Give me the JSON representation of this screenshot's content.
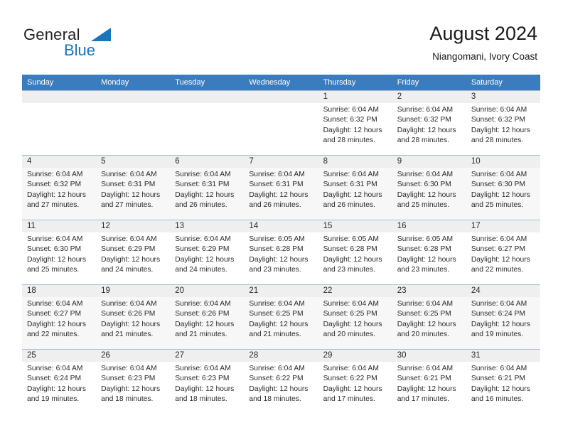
{
  "brand": {
    "line1": "General",
    "line2": "Blue",
    "accent_color": "#1b75bb"
  },
  "header": {
    "title": "August 2024",
    "subtitle": "Niangomani, Ivory Coast"
  },
  "theme": {
    "header_bar_color": "#3a7cbe",
    "daynum_band_color": "#efefef",
    "alt_row_color": "#f7f7f7",
    "grid_line_color": "#a8bfd4"
  },
  "weekdays": [
    "Sunday",
    "Monday",
    "Tuesday",
    "Wednesday",
    "Thursday",
    "Friday",
    "Saturday"
  ],
  "weeks": [
    [
      {
        "day": "",
        "empty": true
      },
      {
        "day": "",
        "empty": true
      },
      {
        "day": "",
        "empty": true
      },
      {
        "day": "",
        "empty": true
      },
      {
        "day": "1",
        "sunrise": "Sunrise: 6:04 AM",
        "sunset": "Sunset: 6:32 PM",
        "daylight1": "Daylight: 12 hours",
        "daylight2": "and 28 minutes."
      },
      {
        "day": "2",
        "sunrise": "Sunrise: 6:04 AM",
        "sunset": "Sunset: 6:32 PM",
        "daylight1": "Daylight: 12 hours",
        "daylight2": "and 28 minutes."
      },
      {
        "day": "3",
        "sunrise": "Sunrise: 6:04 AM",
        "sunset": "Sunset: 6:32 PM",
        "daylight1": "Daylight: 12 hours",
        "daylight2": "and 28 minutes."
      }
    ],
    [
      {
        "day": "4",
        "sunrise": "Sunrise: 6:04 AM",
        "sunset": "Sunset: 6:32 PM",
        "daylight1": "Daylight: 12 hours",
        "daylight2": "and 27 minutes."
      },
      {
        "day": "5",
        "sunrise": "Sunrise: 6:04 AM",
        "sunset": "Sunset: 6:31 PM",
        "daylight1": "Daylight: 12 hours",
        "daylight2": "and 27 minutes."
      },
      {
        "day": "6",
        "sunrise": "Sunrise: 6:04 AM",
        "sunset": "Sunset: 6:31 PM",
        "daylight1": "Daylight: 12 hours",
        "daylight2": "and 26 minutes."
      },
      {
        "day": "7",
        "sunrise": "Sunrise: 6:04 AM",
        "sunset": "Sunset: 6:31 PM",
        "daylight1": "Daylight: 12 hours",
        "daylight2": "and 26 minutes."
      },
      {
        "day": "8",
        "sunrise": "Sunrise: 6:04 AM",
        "sunset": "Sunset: 6:31 PM",
        "daylight1": "Daylight: 12 hours",
        "daylight2": "and 26 minutes."
      },
      {
        "day": "9",
        "sunrise": "Sunrise: 6:04 AM",
        "sunset": "Sunset: 6:30 PM",
        "daylight1": "Daylight: 12 hours",
        "daylight2": "and 25 minutes."
      },
      {
        "day": "10",
        "sunrise": "Sunrise: 6:04 AM",
        "sunset": "Sunset: 6:30 PM",
        "daylight1": "Daylight: 12 hours",
        "daylight2": "and 25 minutes."
      }
    ],
    [
      {
        "day": "11",
        "sunrise": "Sunrise: 6:04 AM",
        "sunset": "Sunset: 6:30 PM",
        "daylight1": "Daylight: 12 hours",
        "daylight2": "and 25 minutes."
      },
      {
        "day": "12",
        "sunrise": "Sunrise: 6:04 AM",
        "sunset": "Sunset: 6:29 PM",
        "daylight1": "Daylight: 12 hours",
        "daylight2": "and 24 minutes."
      },
      {
        "day": "13",
        "sunrise": "Sunrise: 6:04 AM",
        "sunset": "Sunset: 6:29 PM",
        "daylight1": "Daylight: 12 hours",
        "daylight2": "and 24 minutes."
      },
      {
        "day": "14",
        "sunrise": "Sunrise: 6:05 AM",
        "sunset": "Sunset: 6:28 PM",
        "daylight1": "Daylight: 12 hours",
        "daylight2": "and 23 minutes."
      },
      {
        "day": "15",
        "sunrise": "Sunrise: 6:05 AM",
        "sunset": "Sunset: 6:28 PM",
        "daylight1": "Daylight: 12 hours",
        "daylight2": "and 23 minutes."
      },
      {
        "day": "16",
        "sunrise": "Sunrise: 6:05 AM",
        "sunset": "Sunset: 6:28 PM",
        "daylight1": "Daylight: 12 hours",
        "daylight2": "and 23 minutes."
      },
      {
        "day": "17",
        "sunrise": "Sunrise: 6:04 AM",
        "sunset": "Sunset: 6:27 PM",
        "daylight1": "Daylight: 12 hours",
        "daylight2": "and 22 minutes."
      }
    ],
    [
      {
        "day": "18",
        "sunrise": "Sunrise: 6:04 AM",
        "sunset": "Sunset: 6:27 PM",
        "daylight1": "Daylight: 12 hours",
        "daylight2": "and 22 minutes."
      },
      {
        "day": "19",
        "sunrise": "Sunrise: 6:04 AM",
        "sunset": "Sunset: 6:26 PM",
        "daylight1": "Daylight: 12 hours",
        "daylight2": "and 21 minutes."
      },
      {
        "day": "20",
        "sunrise": "Sunrise: 6:04 AM",
        "sunset": "Sunset: 6:26 PM",
        "daylight1": "Daylight: 12 hours",
        "daylight2": "and 21 minutes."
      },
      {
        "day": "21",
        "sunrise": "Sunrise: 6:04 AM",
        "sunset": "Sunset: 6:25 PM",
        "daylight1": "Daylight: 12 hours",
        "daylight2": "and 21 minutes."
      },
      {
        "day": "22",
        "sunrise": "Sunrise: 6:04 AM",
        "sunset": "Sunset: 6:25 PM",
        "daylight1": "Daylight: 12 hours",
        "daylight2": "and 20 minutes."
      },
      {
        "day": "23",
        "sunrise": "Sunrise: 6:04 AM",
        "sunset": "Sunset: 6:25 PM",
        "daylight1": "Daylight: 12 hours",
        "daylight2": "and 20 minutes."
      },
      {
        "day": "24",
        "sunrise": "Sunrise: 6:04 AM",
        "sunset": "Sunset: 6:24 PM",
        "daylight1": "Daylight: 12 hours",
        "daylight2": "and 19 minutes."
      }
    ],
    [
      {
        "day": "25",
        "sunrise": "Sunrise: 6:04 AM",
        "sunset": "Sunset: 6:24 PM",
        "daylight1": "Daylight: 12 hours",
        "daylight2": "and 19 minutes."
      },
      {
        "day": "26",
        "sunrise": "Sunrise: 6:04 AM",
        "sunset": "Sunset: 6:23 PM",
        "daylight1": "Daylight: 12 hours",
        "daylight2": "and 18 minutes."
      },
      {
        "day": "27",
        "sunrise": "Sunrise: 6:04 AM",
        "sunset": "Sunset: 6:23 PM",
        "daylight1": "Daylight: 12 hours",
        "daylight2": "and 18 minutes."
      },
      {
        "day": "28",
        "sunrise": "Sunrise: 6:04 AM",
        "sunset": "Sunset: 6:22 PM",
        "daylight1": "Daylight: 12 hours",
        "daylight2": "and 18 minutes."
      },
      {
        "day": "29",
        "sunrise": "Sunrise: 6:04 AM",
        "sunset": "Sunset: 6:22 PM",
        "daylight1": "Daylight: 12 hours",
        "daylight2": "and 17 minutes."
      },
      {
        "day": "30",
        "sunrise": "Sunrise: 6:04 AM",
        "sunset": "Sunset: 6:21 PM",
        "daylight1": "Daylight: 12 hours",
        "daylight2": "and 17 minutes."
      },
      {
        "day": "31",
        "sunrise": "Sunrise: 6:04 AM",
        "sunset": "Sunset: 6:21 PM",
        "daylight1": "Daylight: 12 hours",
        "daylight2": "and 16 minutes."
      }
    ]
  ]
}
